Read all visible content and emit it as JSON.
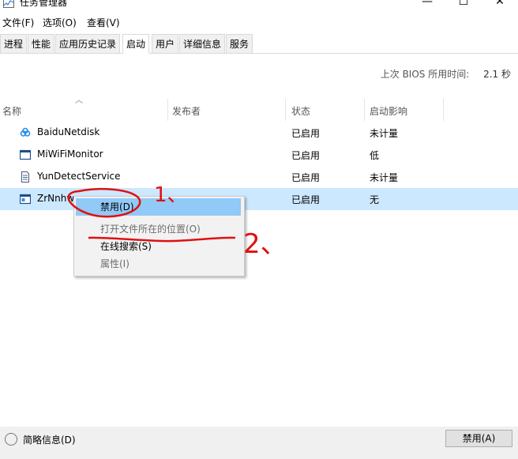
{
  "window": {
    "title": "任务管理器",
    "minimize": "—",
    "maximize": "☐",
    "close": "✕"
  },
  "menu": [
    "文件(F)",
    "选项(O)",
    "查看(V)"
  ],
  "tabs": [
    {
      "label": "进程"
    },
    {
      "label": "性能"
    },
    {
      "label": "应用历史记录"
    },
    {
      "label": "启动",
      "active": true
    },
    {
      "label": "用户"
    },
    {
      "label": "详细信息"
    },
    {
      "label": "服务"
    }
  ],
  "bios": {
    "label": "上次 BIOS 所用时间:",
    "value": "2.1 秒"
  },
  "columns": {
    "name": "名称",
    "publisher": "发布者",
    "status": "状态",
    "impact": "启动影响"
  },
  "rows": [
    {
      "name": "BaiduNetdisk",
      "publisher": "",
      "status": "已启用",
      "impact": "未计量",
      "icon": "baidu-netdisk-icon"
    },
    {
      "name": "MiWiFiMonitor",
      "publisher": "",
      "status": "已启用",
      "impact": "低",
      "icon": "window-icon"
    },
    {
      "name": "YunDetectService",
      "publisher": "",
      "status": "已启用",
      "impact": "未计量",
      "icon": "document-icon"
    },
    {
      "name": "ZrNnhw",
      "publisher": "",
      "status": "已启用",
      "impact": "无",
      "icon": "app-window-icon",
      "selected": true
    }
  ],
  "context_menu": [
    {
      "label": "禁用(D)",
      "highlighted": true
    },
    {
      "label": "打开文件所在的位置(O)",
      "disabled": true
    },
    {
      "label": "在线搜索(S)"
    },
    {
      "label": "属性(I)",
      "disabled": true
    }
  ],
  "annotations": {
    "one": "1、",
    "two": "2、"
  },
  "footer": {
    "fewer_details": "简略信息(D)",
    "disable_button": "禁用(A)"
  },
  "colors": {
    "selected_row": "#cce8ff",
    "menu_highlight": "#91c9f7",
    "annotation": "#e01010"
  }
}
